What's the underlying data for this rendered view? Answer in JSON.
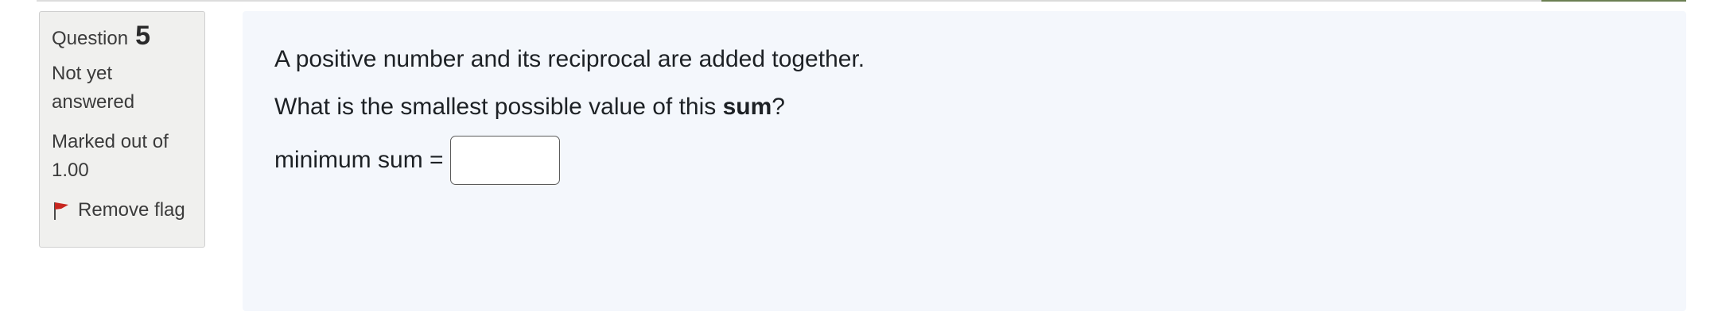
{
  "question_info": {
    "label": "Question",
    "number": "5",
    "state_line1": "Not yet",
    "state_line2": "answered",
    "grade_line1": "Marked out of",
    "grade_line2": "1.00",
    "flag_label": "Remove flag",
    "flag_icon": "flag-icon"
  },
  "question": {
    "text_line1": "A positive number and its reciprocal are added together.",
    "text_line2_prefix": "What is the smallest possible value of this ",
    "text_line2_bold": "sum",
    "text_line2_suffix": "?",
    "answer_label": "minimum sum =",
    "answer_value": ""
  },
  "colors": {
    "info_bg": "#f0f0ee",
    "content_bg": "#f4f7fc",
    "flag_red": "#c8261f"
  }
}
